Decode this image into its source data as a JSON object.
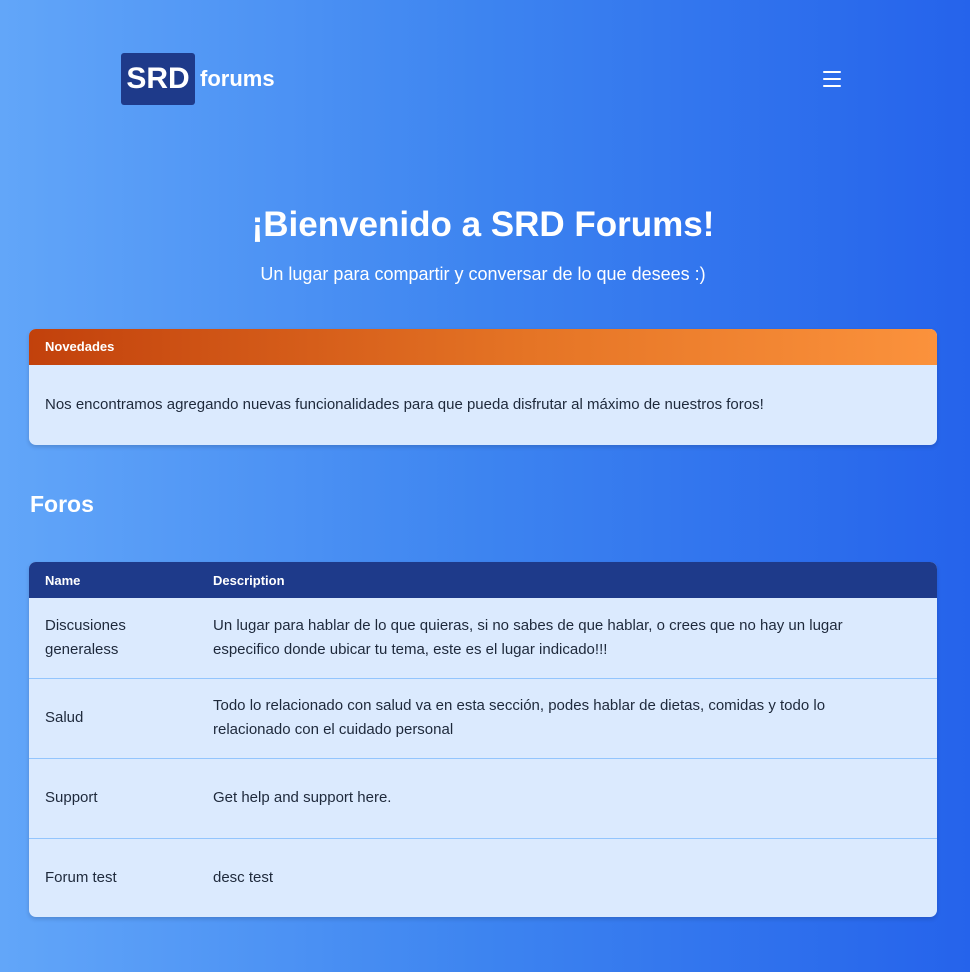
{
  "header": {
    "logo_box": "SRD",
    "logo_text": "forums",
    "menu_icon": "hamburger-menu-icon"
  },
  "hero": {
    "title": "¡Bienvenido a SRD Forums!",
    "subtitle": "Un lugar para compartir y conversar de lo que desees :)"
  },
  "news": {
    "title": "Novedades",
    "body": "Nos encontramos agregando nuevas funcionalidades para que pueda disfrutar al máximo de nuestros foros!"
  },
  "forums": {
    "title": "Foros",
    "columns": {
      "name": "Name",
      "description": "Description"
    },
    "rows": [
      {
        "name": "Discusiones generaless",
        "description": "Un lugar para hablar de lo que quieras, si no sabes de que hablar, o crees que no hay un lugar especifico donde ubicar tu tema, este es el lugar indicado!!!"
      },
      {
        "name": "Salud",
        "description": "Todo lo relacionado con salud va en esta sección, podes hablar de dietas, comidas y todo lo relacionado con el cuidado personal"
      },
      {
        "name": "Support",
        "description": "Get help and support here."
      },
      {
        "name": "Forum test",
        "description": "desc test"
      }
    ]
  },
  "colors": {
    "background_start": "#62a6f9",
    "background_end": "#2563eb",
    "logo_box": "#1e3a8a",
    "news_header_start": "#c2410c",
    "news_header_end": "#fb923c",
    "card_background": "#dbeafe",
    "table_header": "#1e3a8a",
    "row_divider": "#93c5fd"
  }
}
